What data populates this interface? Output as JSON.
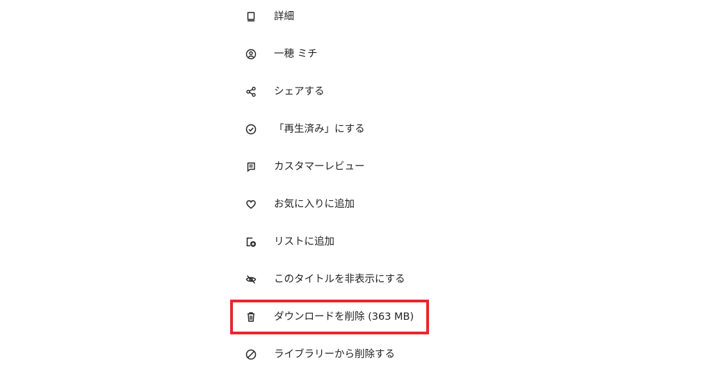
{
  "menu": {
    "items": [
      {
        "label": "詳細",
        "icon": "book-icon"
      },
      {
        "label": "一穂 ミチ",
        "icon": "author-icon"
      },
      {
        "label": "シェアする",
        "icon": "share-icon"
      },
      {
        "label": "「再生済み」にする",
        "icon": "check-circle-icon"
      },
      {
        "label": "カスタマーレビュー",
        "icon": "review-icon"
      },
      {
        "label": "お気に入りに追加",
        "icon": "heart-icon"
      },
      {
        "label": "リストに追加",
        "icon": "add-to-list-icon"
      },
      {
        "label": "このタイトルを非表示にする",
        "icon": "hide-icon"
      },
      {
        "label": "ダウンロードを削除 (363 MB)",
        "icon": "trash-icon"
      },
      {
        "label": "ライブラリーから削除する",
        "icon": "remove-circle-icon"
      }
    ]
  },
  "highlight": {
    "color": "#e8272d",
    "target": "ダウンロードを削除 (363 MB)"
  }
}
